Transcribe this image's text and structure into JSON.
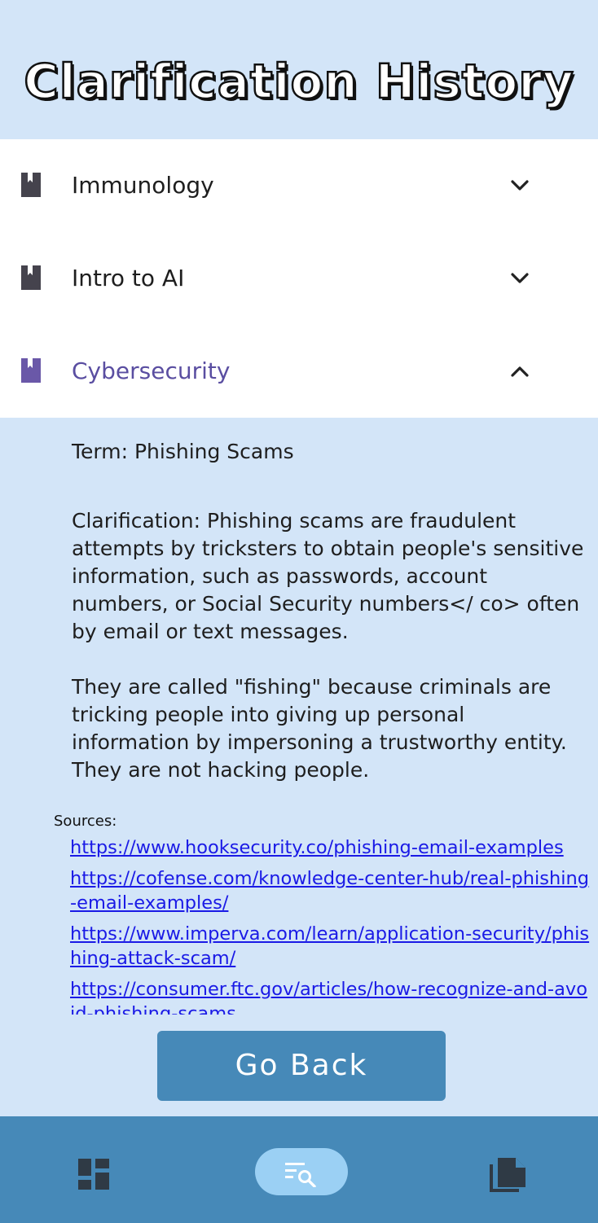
{
  "header": {
    "title": "Clarification History"
  },
  "courses": [
    {
      "label": "Immunology",
      "icon": "book-icon",
      "expanded": false
    },
    {
      "label": "Intro to AI",
      "icon": "book-icon",
      "expanded": false
    },
    {
      "label": "Cybersecurity",
      "icon": "book-icon",
      "expanded": true
    }
  ],
  "clarification": {
    "term": "Term: Phishing Scams",
    "paragraph1": "Clarification: Phishing scams are fraudulent attempts by tricksters to obtain people's sensitive information, such as passwords, account numbers, or Social Security numbers</ co> often by email or text messages.",
    "paragraph2": "They are called \"fishing\" because criminals are tricking people into giving up personal information by impersoning a trustworthy entity. They are not hacking people.",
    "sources_label": "Sources:",
    "sources": [
      "https://www.hooksecurity.co/phishing-email-examples",
      "https://cofense.com/knowledge-center-hub/real-phishing-email-examples/",
      "https://www.imperva.com/learn/application-security/phishing-attack-scam/",
      "https://consumer.ftc.gov/articles/how-recognize-and-avoid-phishing-scams"
    ]
  },
  "actions": {
    "go_back_label": "Go Back"
  },
  "bottom_nav": [
    {
      "name": "dashboard-icon",
      "active": false
    },
    {
      "name": "search-list-icon",
      "active": true
    },
    {
      "name": "documents-icon",
      "active": false
    }
  ],
  "colors": {
    "background": "#d3e5f8",
    "accent_purple": "#5a4ea1",
    "button_blue": "#4689b8",
    "active_pill": "#9bd0f4",
    "link": "#1a1ae6"
  }
}
